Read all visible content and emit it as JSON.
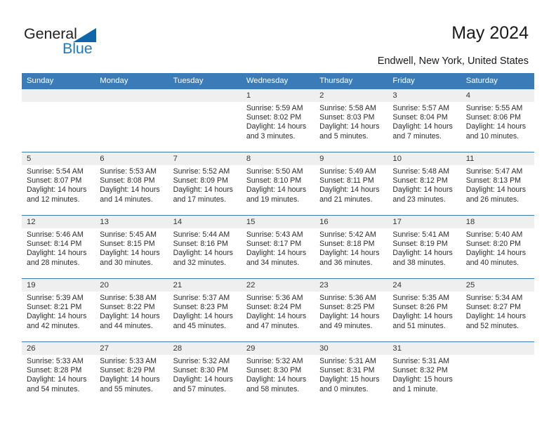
{
  "brand": {
    "name_part1": "General",
    "name_part2": "Blue",
    "triangle_color": "#1165a8",
    "blue_color": "#1f7ac4"
  },
  "header": {
    "title": "May 2024",
    "location": "Endwell, New York, United States",
    "header_bg": "#3b7cb8",
    "daynum_bg": "#efefef"
  },
  "weekdays": [
    "Sunday",
    "Monday",
    "Tuesday",
    "Wednesday",
    "Thursday",
    "Friday",
    "Saturday"
  ],
  "labels": {
    "sunrise_prefix": "Sunrise:",
    "sunset_prefix": "Sunset:",
    "daylight_prefix": "Daylight:"
  },
  "weeks": [
    [
      {
        "day": "",
        "empty": true
      },
      {
        "day": "",
        "empty": true
      },
      {
        "day": "",
        "empty": true
      },
      {
        "day": "1",
        "sunrise": "Sunrise: 5:59 AM",
        "sunset": "Sunset: 8:02 PM",
        "daylight": "Daylight: 14 hours and 3 minutes."
      },
      {
        "day": "2",
        "sunrise": "Sunrise: 5:58 AM",
        "sunset": "Sunset: 8:03 PM",
        "daylight": "Daylight: 14 hours and 5 minutes."
      },
      {
        "day": "3",
        "sunrise": "Sunrise: 5:57 AM",
        "sunset": "Sunset: 8:04 PM",
        "daylight": "Daylight: 14 hours and 7 minutes."
      },
      {
        "day": "4",
        "sunrise": "Sunrise: 5:55 AM",
        "sunset": "Sunset: 8:06 PM",
        "daylight": "Daylight: 14 hours and 10 minutes."
      }
    ],
    [
      {
        "day": "5",
        "sunrise": "Sunrise: 5:54 AM",
        "sunset": "Sunset: 8:07 PM",
        "daylight": "Daylight: 14 hours and 12 minutes."
      },
      {
        "day": "6",
        "sunrise": "Sunrise: 5:53 AM",
        "sunset": "Sunset: 8:08 PM",
        "daylight": "Daylight: 14 hours and 14 minutes."
      },
      {
        "day": "7",
        "sunrise": "Sunrise: 5:52 AM",
        "sunset": "Sunset: 8:09 PM",
        "daylight": "Daylight: 14 hours and 17 minutes."
      },
      {
        "day": "8",
        "sunrise": "Sunrise: 5:50 AM",
        "sunset": "Sunset: 8:10 PM",
        "daylight": "Daylight: 14 hours and 19 minutes."
      },
      {
        "day": "9",
        "sunrise": "Sunrise: 5:49 AM",
        "sunset": "Sunset: 8:11 PM",
        "daylight": "Daylight: 14 hours and 21 minutes."
      },
      {
        "day": "10",
        "sunrise": "Sunrise: 5:48 AM",
        "sunset": "Sunset: 8:12 PM",
        "daylight": "Daylight: 14 hours and 23 minutes."
      },
      {
        "day": "11",
        "sunrise": "Sunrise: 5:47 AM",
        "sunset": "Sunset: 8:13 PM",
        "daylight": "Daylight: 14 hours and 26 minutes."
      }
    ],
    [
      {
        "day": "12",
        "sunrise": "Sunrise: 5:46 AM",
        "sunset": "Sunset: 8:14 PM",
        "daylight": "Daylight: 14 hours and 28 minutes."
      },
      {
        "day": "13",
        "sunrise": "Sunrise: 5:45 AM",
        "sunset": "Sunset: 8:15 PM",
        "daylight": "Daylight: 14 hours and 30 minutes."
      },
      {
        "day": "14",
        "sunrise": "Sunrise: 5:44 AM",
        "sunset": "Sunset: 8:16 PM",
        "daylight": "Daylight: 14 hours and 32 minutes."
      },
      {
        "day": "15",
        "sunrise": "Sunrise: 5:43 AM",
        "sunset": "Sunset: 8:17 PM",
        "daylight": "Daylight: 14 hours and 34 minutes."
      },
      {
        "day": "16",
        "sunrise": "Sunrise: 5:42 AM",
        "sunset": "Sunset: 8:18 PM",
        "daylight": "Daylight: 14 hours and 36 minutes."
      },
      {
        "day": "17",
        "sunrise": "Sunrise: 5:41 AM",
        "sunset": "Sunset: 8:19 PM",
        "daylight": "Daylight: 14 hours and 38 minutes."
      },
      {
        "day": "18",
        "sunrise": "Sunrise: 5:40 AM",
        "sunset": "Sunset: 8:20 PM",
        "daylight": "Daylight: 14 hours and 40 minutes."
      }
    ],
    [
      {
        "day": "19",
        "sunrise": "Sunrise: 5:39 AM",
        "sunset": "Sunset: 8:21 PM",
        "daylight": "Daylight: 14 hours and 42 minutes."
      },
      {
        "day": "20",
        "sunrise": "Sunrise: 5:38 AM",
        "sunset": "Sunset: 8:22 PM",
        "daylight": "Daylight: 14 hours and 44 minutes."
      },
      {
        "day": "21",
        "sunrise": "Sunrise: 5:37 AM",
        "sunset": "Sunset: 8:23 PM",
        "daylight": "Daylight: 14 hours and 45 minutes."
      },
      {
        "day": "22",
        "sunrise": "Sunrise: 5:36 AM",
        "sunset": "Sunset: 8:24 PM",
        "daylight": "Daylight: 14 hours and 47 minutes."
      },
      {
        "day": "23",
        "sunrise": "Sunrise: 5:36 AM",
        "sunset": "Sunset: 8:25 PM",
        "daylight": "Daylight: 14 hours and 49 minutes."
      },
      {
        "day": "24",
        "sunrise": "Sunrise: 5:35 AM",
        "sunset": "Sunset: 8:26 PM",
        "daylight": "Daylight: 14 hours and 51 minutes."
      },
      {
        "day": "25",
        "sunrise": "Sunrise: 5:34 AM",
        "sunset": "Sunset: 8:27 PM",
        "daylight": "Daylight: 14 hours and 52 minutes."
      }
    ],
    [
      {
        "day": "26",
        "sunrise": "Sunrise: 5:33 AM",
        "sunset": "Sunset: 8:28 PM",
        "daylight": "Daylight: 14 hours and 54 minutes."
      },
      {
        "day": "27",
        "sunrise": "Sunrise: 5:33 AM",
        "sunset": "Sunset: 8:29 PM",
        "daylight": "Daylight: 14 hours and 55 minutes."
      },
      {
        "day": "28",
        "sunrise": "Sunrise: 5:32 AM",
        "sunset": "Sunset: 8:30 PM",
        "daylight": "Daylight: 14 hours and 57 minutes."
      },
      {
        "day": "29",
        "sunrise": "Sunrise: 5:32 AM",
        "sunset": "Sunset: 8:30 PM",
        "daylight": "Daylight: 14 hours and 58 minutes."
      },
      {
        "day": "30",
        "sunrise": "Sunrise: 5:31 AM",
        "sunset": "Sunset: 8:31 PM",
        "daylight": "Daylight: 15 hours and 0 minutes."
      },
      {
        "day": "31",
        "sunrise": "Sunrise: 5:31 AM",
        "sunset": "Sunset: 8:32 PM",
        "daylight": "Daylight: 15 hours and 1 minute."
      },
      {
        "day": "",
        "empty": true
      }
    ]
  ]
}
